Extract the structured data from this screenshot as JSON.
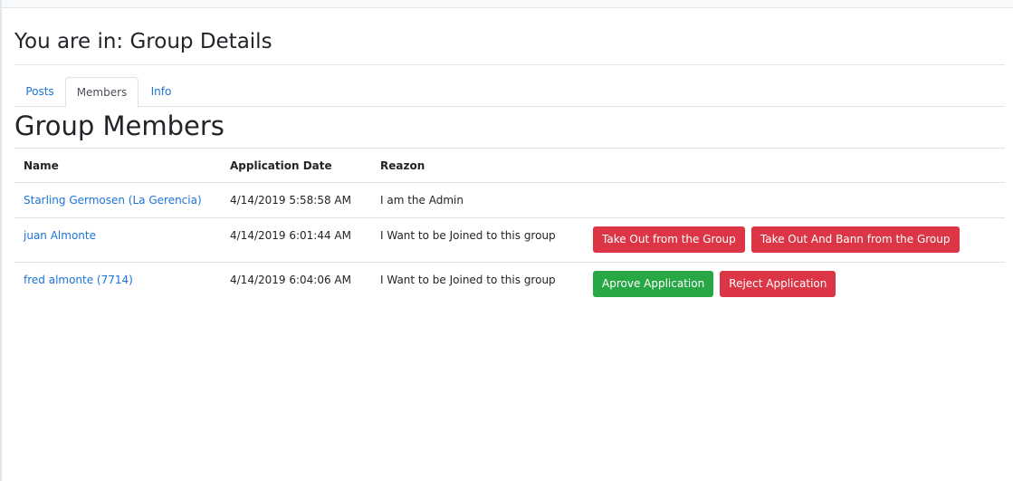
{
  "header": {
    "title": "You are in: Group Details"
  },
  "tabs": [
    {
      "label": "Posts",
      "active": false
    },
    {
      "label": "Members",
      "active": true
    },
    {
      "label": "Info",
      "active": false
    }
  ],
  "section": {
    "title": "Group Members"
  },
  "table": {
    "columns": [
      "Name",
      "Application Date",
      "Reazon"
    ],
    "rows": [
      {
        "name": "Starling Germosen (La Gerencia)",
        "date": "4/14/2019 5:58:58 AM",
        "reason": "I am the Admin",
        "actions": []
      },
      {
        "name": "juan Almonte",
        "date": "4/14/2019 6:01:44 AM",
        "reason": "I Want to be Joined to this group",
        "actions": [
          {
            "label": "Take Out from the Group",
            "style": "danger"
          },
          {
            "label": "Take Out And Bann from the Group",
            "style": "danger"
          }
        ]
      },
      {
        "name": "fred almonte (7714)",
        "date": "4/14/2019 6:04:06 AM",
        "reason": "I Want to be Joined to this group",
        "actions": [
          {
            "label": "Aprove Application",
            "style": "success"
          },
          {
            "label": "Reject Application",
            "style": "danger"
          }
        ]
      }
    ]
  },
  "colors": {
    "link": "#1a73d8",
    "danger": "#dc3545",
    "success": "#28a745",
    "border": "#dee2e6"
  }
}
